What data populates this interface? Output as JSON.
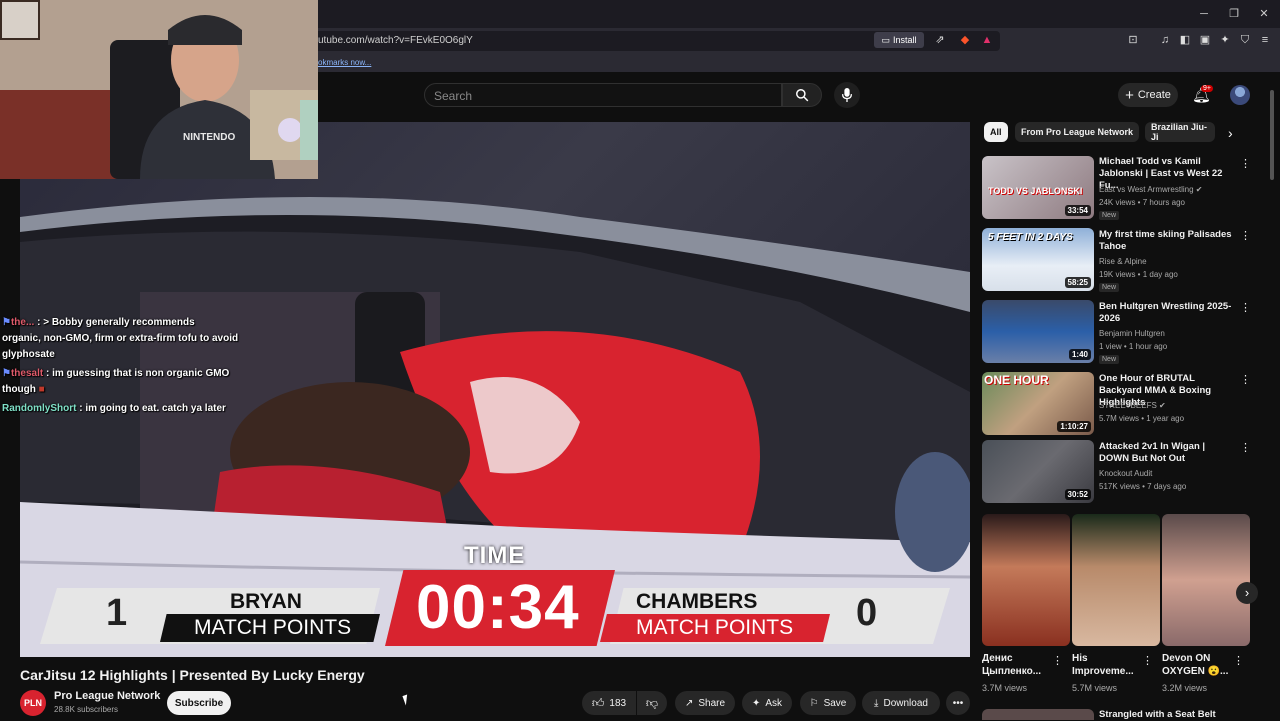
{
  "browser": {
    "url": "utube.com/watch?v=FEvkE0O6glY",
    "install_label": "Install",
    "bookmarks_hint": "okmarks now..."
  },
  "header": {
    "search_placeholder": "Search",
    "create_label": "Create",
    "notification_count": "9+"
  },
  "chat": [
    {
      "user": "the...",
      "text": ": > Bobby generally recommends",
      "user_color": "#e05a6a"
    },
    {
      "user": "",
      "text": "organic, non-GMO, firm or extra-firm tofu to avoid",
      "user_color": "#ffffff"
    },
    {
      "user": "",
      "text": "glyphosate",
      "user_color": "#ffffff"
    },
    {
      "user": "thesalt",
      "text": ": im guessing that is non organic GMO",
      "user_color": "#e05a6a"
    },
    {
      "user": "",
      "text": "though",
      "user_color": "#ffffff"
    },
    {
      "user": "RandomlyShort",
      "text": ": im going to eat. catch ya later",
      "user_color": "#7fe0c7"
    }
  ],
  "scoreboard": {
    "time_label": "TIME",
    "clock": "00:34",
    "left": {
      "name": "BRYAN",
      "points": "1",
      "sub": "MATCH POINTS"
    },
    "right": {
      "name": "CHAMBERS",
      "points": "0",
      "sub": "MATCH POINTS"
    }
  },
  "video": {
    "title": "CarJitsu 12 Highlights | Presented By Lucky Energy",
    "channel_initials": "PLN",
    "channel_name": "Pro League Network",
    "subscribers": "28.8K subscribers",
    "subscribe_label": "Subscribe",
    "likes": "183",
    "share_label": "Share",
    "ask_label": "Ask",
    "save_label": "Save",
    "download_label": "Download"
  },
  "chips": [
    "All",
    "From Pro League Network",
    "Brazilian Jiu-Ji"
  ],
  "recommendations": [
    {
      "title": "Michael Todd vs Kamil Jablonski | East vs West 22 Fu...",
      "channel": "East vs West Armwrestling",
      "stats": "24K views • 7 hours ago",
      "badge": "New",
      "duration": "33:54",
      "verified": true
    },
    {
      "title": "My first time skiing Palisades Tahoe",
      "channel": "Rise & Alpine",
      "stats": "19K views • 1 day ago",
      "badge": "New",
      "duration": "58:25",
      "overlay": "5 FEET IN 2 DAYS"
    },
    {
      "title": "Ben Hultgren Wrestling 2025-2026",
      "channel": "Benjamin Hultgren",
      "stats": "1 view • 1 hour ago",
      "badge": "New",
      "duration": "1:40"
    },
    {
      "title": "One Hour of BRUTAL Backyard MMA & Boxing Highlights",
      "channel": "STREETBEEFS",
      "stats": "5.7M views • 1 year ago",
      "badge": "",
      "duration": "1:10:27",
      "overlay": "ONE HOUR",
      "verified": true
    },
    {
      "title": "Attacked 2v1 In Wigan | DOWN But Not Out",
      "channel": "Knockout Audit",
      "stats": "517K views • 7 days ago",
      "badge": "",
      "duration": "30:52"
    }
  ],
  "shorts": [
    {
      "title": "Денис Цыпленко...",
      "views": "3.7M views"
    },
    {
      "title": "His Improveme...",
      "views": "5.7M views"
    },
    {
      "title": "Devon ON OXYGEN 😮...",
      "views": "3.2M views"
    }
  ],
  "next_rec_title": "Strangled with a Seat Belt"
}
